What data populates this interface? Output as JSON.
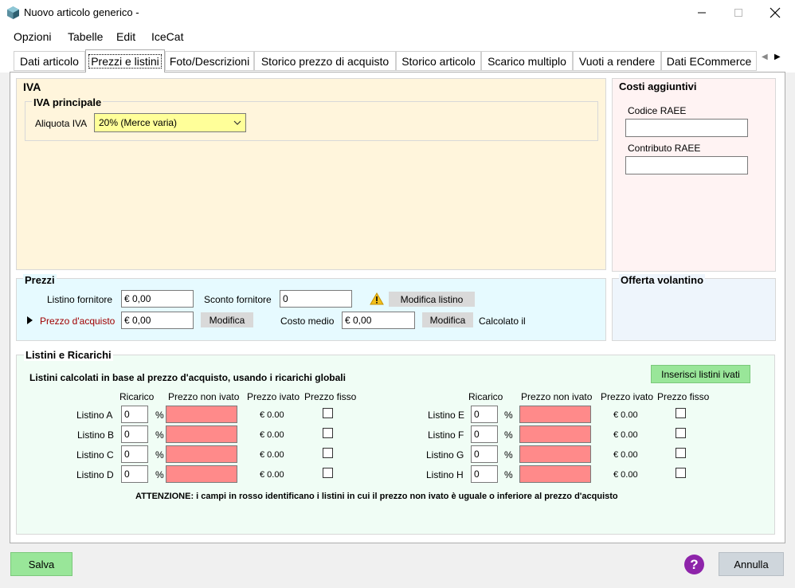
{
  "window": {
    "title": "Nuovo articolo generico -",
    "minimize_icon": "minimize-icon",
    "maximize_icon": "maximize-icon",
    "close_icon": "close-icon"
  },
  "menu": [
    "Opzioni",
    "Tabelle",
    "Edit",
    "IceCat"
  ],
  "tabs": [
    "Dati articolo",
    "Prezzi e listini",
    "Foto/Descrizioni",
    "Storico prezzo di acquisto",
    "Storico articolo",
    "Scarico multiplo",
    "Vuoti a rendere",
    "Dati ECommerce"
  ],
  "active_tab": "Prezzi e listini",
  "iva": {
    "title": "IVA",
    "subgroup_title": "IVA principale",
    "aliquota_label": "Aliquota IVA",
    "aliquota_value": "20% (Merce varia)"
  },
  "costi": {
    "title": "Costi aggiuntivi",
    "codice_raee_label": "Codice RAEE",
    "codice_raee_value": "",
    "contributo_raee_label": "Contributo RAEE",
    "contributo_raee_value": ""
  },
  "prezzi": {
    "title": "Prezzi",
    "listino_fornitore_label": "Listino fornitore",
    "listino_fornitore_value": "€ 0,00",
    "sconto_fornitore_label": "Sconto fornitore",
    "sconto_fornitore_value": "0",
    "modifica_listino_label": "Modifica listino",
    "prezzo_acquisto_label": "Prezzo d'acquisto",
    "prezzo_acquisto_value": "€ 0,00",
    "modifica_label": "Modifica",
    "costo_medio_label": "Costo medio",
    "costo_medio_value": "€ 0,00",
    "modifica2_label": "Modifica",
    "calcolato_label": "Calcolato il"
  },
  "offerta": {
    "title": "Offerta volantino"
  },
  "listini": {
    "title": "Listini e Ricarichi",
    "subtitle": "Listini calcolati in base al prezzo d'acquisto, usando i ricarichi globali",
    "inserisci_label": "Inserisci listini ivati",
    "headers": {
      "ricarico": "Ricarico",
      "prezzo_non_ivato": "Prezzo non ivato",
      "prezzo_ivato": "Prezzo ivato",
      "prezzo_fisso": "Prezzo fisso"
    },
    "percent": "%",
    "left_rows": [
      {
        "name": "Listino A",
        "ricarico": "0",
        "ivato": "€ 0.00"
      },
      {
        "name": "Listino B",
        "ricarico": "0",
        "ivato": "€ 0.00"
      },
      {
        "name": "Listino C",
        "ricarico": "0",
        "ivato": "€ 0.00"
      },
      {
        "name": "Listino D",
        "ricarico": "0",
        "ivato": "€ 0.00"
      }
    ],
    "right_rows": [
      {
        "name": "Listino E",
        "ricarico": "0",
        "ivato": "€ 0.00"
      },
      {
        "name": "Listino F",
        "ricarico": "0",
        "ivato": "€ 0.00"
      },
      {
        "name": "Listino G",
        "ricarico": "0",
        "ivato": "€ 0.00"
      },
      {
        "name": "Listino H",
        "ricarico": "0",
        "ivato": "€ 0.00"
      }
    ],
    "attenzione": "ATTENZIONE: i campi in rosso identificano i listini in cui il prezzo non ivato è uguale o inferiore al prezzo d'acquisto"
  },
  "footer": {
    "salva_label": "Salva",
    "annulla_label": "Annulla",
    "help_icon": "help-icon"
  },
  "colors": {
    "iva_bg": "#fff5dc",
    "costi_bg": "#fff3f3",
    "prezzi_bg": "#e6faff",
    "offerta_bg": "#eef5fc",
    "listini_bg": "#f0fdf5",
    "green_button": "#99e699",
    "red_field": "#ff8a8a",
    "aliquota_bg": "#ffff99",
    "prezzo_acquisto_label": "#a00000",
    "help_purple": "#8e24aa"
  }
}
